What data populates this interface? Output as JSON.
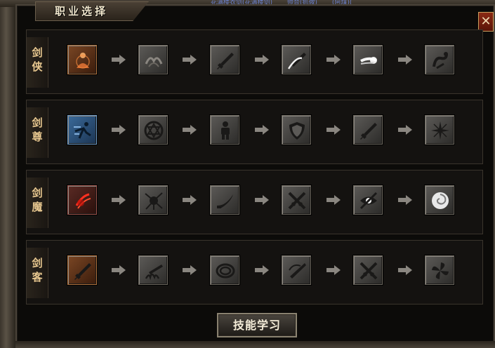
{
  "window": {
    "title": "职业选择",
    "close_label": "✕"
  },
  "top_strip": {
    "left_text": "花满楼衣剑(花满楼剑)",
    "mid_text": "帅合(抓微)",
    "right_text": "(阿煤)("
  },
  "rows": [
    {
      "name": "剑侠",
      "chars": [
        "剑",
        "侠"
      ],
      "skills": [
        {
          "icon": "meditate-icon",
          "style": "orange"
        },
        {
          "icon": "faded-wings-icon",
          "style": "gray"
        },
        {
          "icon": "sword-icon",
          "style": "gray"
        },
        {
          "icon": "slash-sword-icon",
          "style": "gray"
        },
        {
          "icon": "energy-burst-icon",
          "style": "gray"
        },
        {
          "icon": "dragon-icon",
          "style": "gray"
        }
      ]
    },
    {
      "name": "剑尊",
      "chars": [
        "剑",
        "尊"
      ],
      "skills": [
        {
          "icon": "dash-figure-icon",
          "style": "blue"
        },
        {
          "icon": "hexagram-icon",
          "style": "gray"
        },
        {
          "icon": "armor-figure-icon",
          "style": "gray"
        },
        {
          "icon": "shield-icon",
          "style": "gray"
        },
        {
          "icon": "sword-icon",
          "style": "gray"
        },
        {
          "icon": "star-burst-icon",
          "style": "gray"
        }
      ]
    },
    {
      "name": "剑魔",
      "chars": [
        "剑",
        "魔"
      ],
      "skills": [
        {
          "icon": "blood-claw-icon",
          "style": "red"
        },
        {
          "icon": "crack-icon",
          "style": "gray"
        },
        {
          "icon": "curved-blade-icon",
          "style": "gray"
        },
        {
          "icon": "crossed-swords-icon",
          "style": "gray"
        },
        {
          "icon": "eye-slash-icon",
          "style": "gray"
        },
        {
          "icon": "vortex-icon",
          "style": "gray"
        }
      ]
    },
    {
      "name": "剑客",
      "chars": [
        "剑",
        "客"
      ],
      "skills": [
        {
          "icon": "sword-icon",
          "style": "orange"
        },
        {
          "icon": "sword-flame-icon",
          "style": "gray"
        },
        {
          "icon": "spiral-ring-icon",
          "style": "gray"
        },
        {
          "icon": "swirl-sword-icon",
          "style": "gray"
        },
        {
          "icon": "crossed-swords-icon",
          "style": "gray"
        },
        {
          "icon": "shuriken-icon",
          "style": "gray"
        }
      ]
    }
  ],
  "learn_button": "技能学习"
}
